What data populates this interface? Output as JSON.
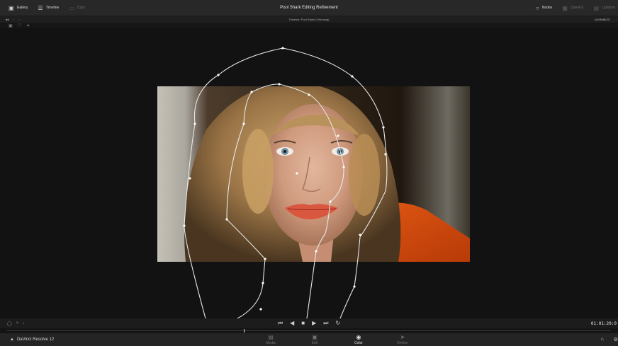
{
  "header": {
    "title": "Pool Shark Editing Refinement",
    "left_tabs": [
      {
        "label": "Gallery",
        "icon": "gallery-icon"
      },
      {
        "label": "Timeline",
        "icon": "timeline-icon"
      },
      {
        "label": "Clips",
        "icon": "clips-icon"
      }
    ],
    "right_tabs": [
      {
        "label": "Nodes",
        "icon": "nodes-icon"
      },
      {
        "label": "OpenFX",
        "icon": "openfx-icon"
      },
      {
        "label": "Lightbox",
        "icon": "lightbox-icon"
      }
    ]
  },
  "subheader": {
    "timeline_title": "Timeline: Pool Shark (Trimming)",
    "timecode": "14:09:48:23"
  },
  "transport": {
    "timecode": "01:01:20:0"
  },
  "footer": {
    "app_name": "DaVinci Resolve 12",
    "pages": [
      {
        "label": "Media",
        "icon": "media-icon",
        "active": false
      },
      {
        "label": "Edit",
        "icon": "edit-icon",
        "active": false
      },
      {
        "label": "Color",
        "icon": "color-icon",
        "active": true
      },
      {
        "label": "Deliver",
        "icon": "deliver-icon",
        "active": false
      }
    ]
  },
  "colors": {
    "spline": "#e8e8e8",
    "accent_active": "#e0e0e0"
  }
}
